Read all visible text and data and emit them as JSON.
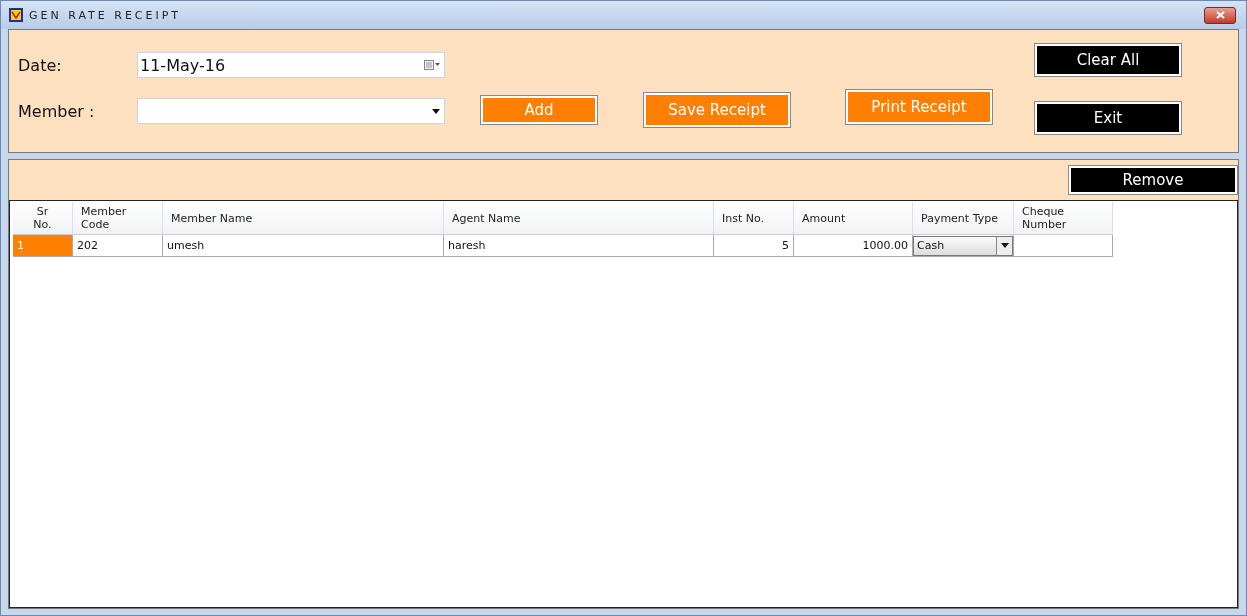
{
  "window": {
    "title": "GEN RATE RECEIPT"
  },
  "form": {
    "date_label": "Date:",
    "date_value": "11-May-16",
    "member_label": "Member :"
  },
  "buttons": [
    {
      "label": "Add",
      "kind": "orange"
    },
    {
      "label": "Save Receipt",
      "kind": "orange"
    },
    {
      "label": "Print Receipt",
      "kind": "orange"
    },
    {
      "label": "Clear All",
      "kind": "black"
    },
    {
      "label": "Exit",
      "kind": "black"
    }
  ],
  "remove_button": {
    "label": "Remove"
  },
  "table": {
    "columns": [
      {
        "label": "Sr No."
      },
      {
        "label": "Member Code"
      },
      {
        "label": "Member Name"
      },
      {
        "label": "Agent Name"
      },
      {
        "label": "Inst No."
      },
      {
        "label": "Amount"
      },
      {
        "label": "Payment Type"
      },
      {
        "label": "Cheque Number"
      }
    ],
    "rows": [
      {
        "selected": true,
        "sr": "1",
        "member_code": "202",
        "member_name": "umesh",
        "agent_name": "haresh",
        "inst_no": "5",
        "amount": "1000.00",
        "payment_type": "Cash"
      }
    ]
  }
}
